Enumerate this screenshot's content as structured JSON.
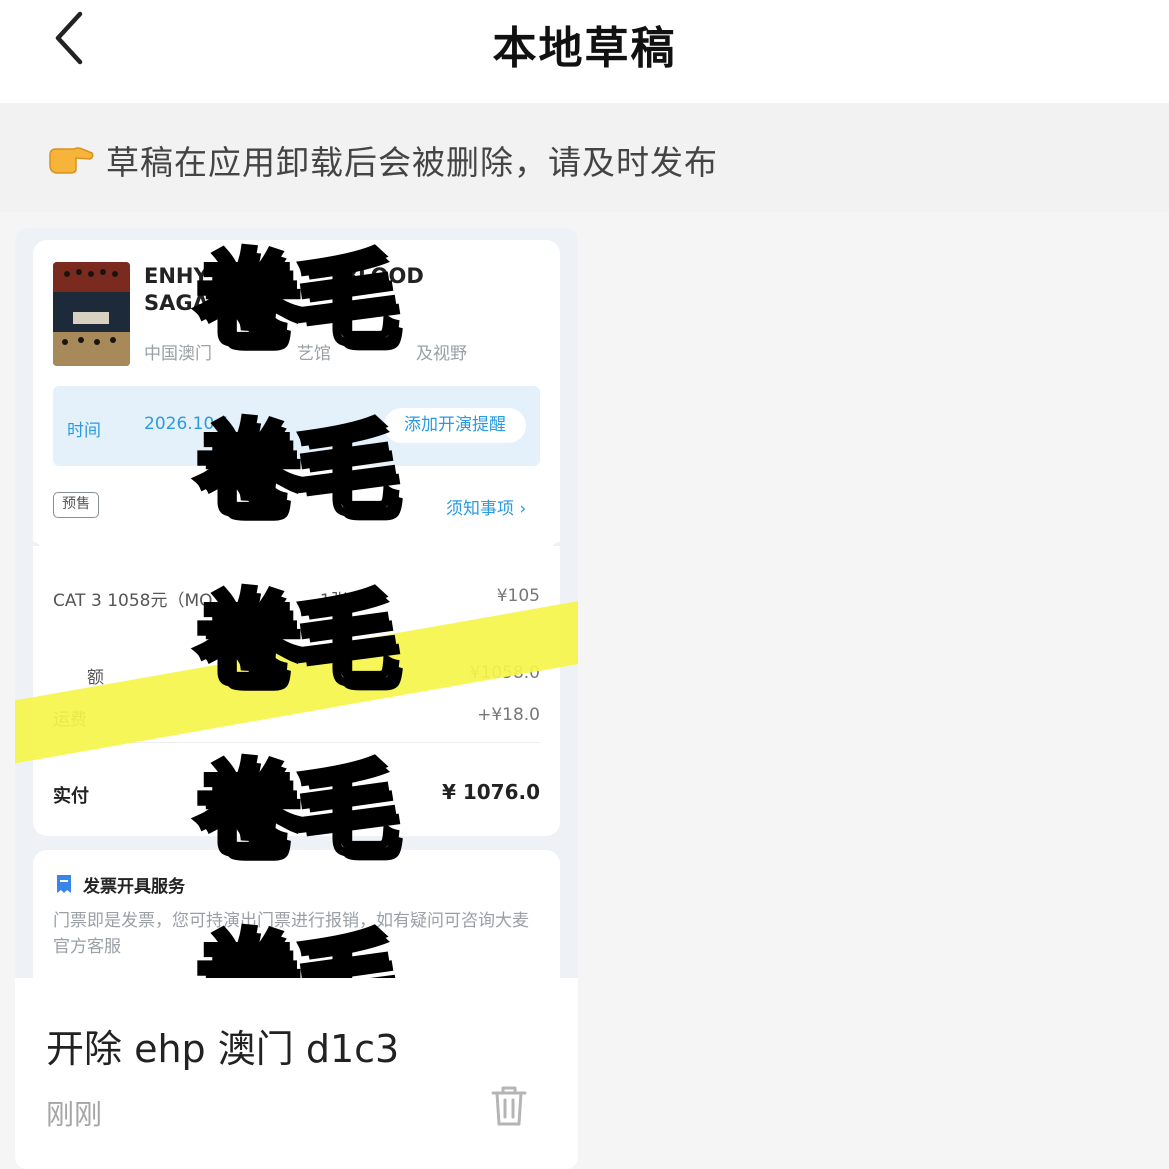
{
  "nav": {
    "title": "本地草稿"
  },
  "tip": {
    "icon": "pointing-hand-emoji",
    "text": "草稿在应用卸载后会被删除，请及时发布"
  },
  "draft": {
    "title": "开除 ehp 澳门 d1c3",
    "time": "刚刚",
    "screenshot": {
      "event_title": "ENHY       BLOOD\nSAGA",
      "venue": "中国澳门     艺馆     及视野",
      "time_label": "时间",
      "time_value": "2026.10.1",
      "remind_button": "添加开演提醒",
      "presale_badge": "预售",
      "notice_link": "须知事项 ›",
      "ticket_line": "CAT 3 1058元（MO       1张",
      "ticket_price": "¥105",
      "subtotal_label": "  额",
      "subtotal_value": "¥1058.0",
      "shipping_label": "运费",
      "shipping_value": "+¥18.0",
      "pay_label": "实付",
      "pay_value": "¥ 1076.0",
      "invoice_title": "发票开具服务",
      "invoice_text": "门票即是发票，您可持演出门票进行报销，如有疑问可咨询大麦官方客服",
      "watermarks": [
        "卷毛",
        "卷毛",
        "卷毛",
        "卷毛",
        "卷毛"
      ],
      "highlight_color": "#f6f54a"
    }
  },
  "colors": {
    "accent": "#2a9be0",
    "background": "#f5f5f5"
  }
}
